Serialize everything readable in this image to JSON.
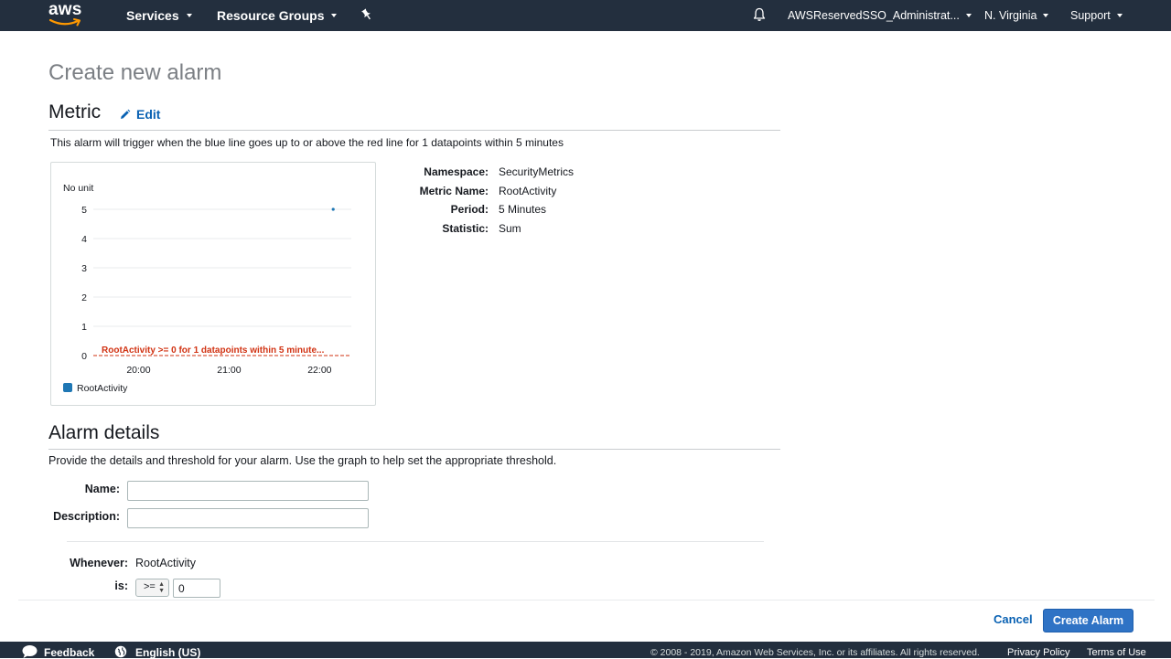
{
  "topnav": {
    "logo_text": "aws",
    "services": "Services",
    "resource_groups": "Resource Groups",
    "account": "AWSReservedSSO_Administrat...",
    "region": "N. Virginia",
    "support": "Support",
    "background": "#232f3e",
    "logo_smile_color": "#ff9900"
  },
  "page": {
    "title": "Create new alarm"
  },
  "metric": {
    "section_title": "Metric",
    "edit_label": "Edit",
    "description": "This alarm will trigger when the blue line goes up to or above the red line for 1 datapoints within 5 minutes",
    "details": [
      {
        "label": "Namespace:",
        "value": "SecurityMetrics"
      },
      {
        "label": "Metric Name:",
        "value": "RootActivity"
      },
      {
        "label": "Period:",
        "value": "5 Minutes"
      },
      {
        "label": "Statistic:",
        "value": "Sum"
      }
    ]
  },
  "chart_data": {
    "type": "line",
    "ylabel": "No unit",
    "yticks": [
      "0",
      "1",
      "2",
      "3",
      "4",
      "5"
    ],
    "ylim": [
      0,
      5
    ],
    "xticks": [
      "20:00",
      "21:00",
      "22:00"
    ],
    "xlim_hours": [
      19.5,
      22.35
    ],
    "series": [
      {
        "name": "RootActivity",
        "color": "#1f77b4",
        "points": [
          {
            "x": 22.15,
            "y": 5
          }
        ]
      }
    ],
    "threshold": {
      "value": 0,
      "label": "RootActivity >= 0 for 1 datapoints within 5 minute...",
      "color": "#d13212"
    },
    "grid": true,
    "legend": "bottom-left"
  },
  "alarm_details": {
    "section_title": "Alarm details",
    "description": "Provide the details and threshold for your alarm. Use the graph to help set the appropriate threshold.",
    "name_label": "Name:",
    "name_value": "",
    "description_label": "Description:",
    "description_value": "",
    "whenever_label": "Whenever:",
    "whenever_value": "RootActivity",
    "is_label": "is:",
    "operator": ">=",
    "threshold_value": "0"
  },
  "actions": {
    "cancel": "Cancel",
    "create": "Create Alarm"
  },
  "footer": {
    "feedback": "Feedback",
    "language": "English (US)",
    "copyright": "© 2008 - 2019, Amazon Web Services, Inc. or its affiliates. All rights reserved.",
    "privacy": "Privacy Policy",
    "terms": "Terms of Use"
  }
}
